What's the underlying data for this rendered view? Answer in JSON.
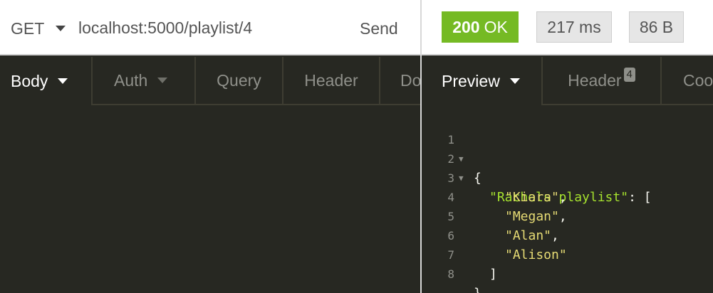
{
  "request": {
    "method": "GET",
    "url": "localhost:5000/playlist/4",
    "send_label": "Send",
    "tabs": [
      {
        "label": "Body"
      },
      {
        "label": "Auth"
      },
      {
        "label": "Query"
      },
      {
        "label": "Header"
      },
      {
        "label": "Do"
      }
    ]
  },
  "response": {
    "status_code": "200",
    "status_text": "OK",
    "time": "217 ms",
    "size": "86 B",
    "tabs": [
      {
        "label": "Preview"
      },
      {
        "label": "Header",
        "count": "4"
      },
      {
        "label": "Coo"
      }
    ],
    "preview": {
      "line_numbers": [
        "1",
        "2",
        "3",
        "4",
        "5",
        "6",
        "7",
        "8"
      ],
      "open_brace": "{",
      "key": "\"Rachels playlist\"",
      "colon_bracket": ": [",
      "values": [
        "\"Kiara\"",
        "\"Megan\"",
        "\"Alan\"",
        "\"Alison\""
      ],
      "comma": ",",
      "close_bracket": "]",
      "close_brace": "}"
    }
  },
  "colors": {
    "status_ok": "#75ba24",
    "editor_bg": "#272822",
    "json_key": "#a6e22e",
    "json_string": "#e6db74"
  },
  "icons": {
    "method_dropdown": "caret-down-icon",
    "fold_marker": "fold-triangle-icon"
  }
}
